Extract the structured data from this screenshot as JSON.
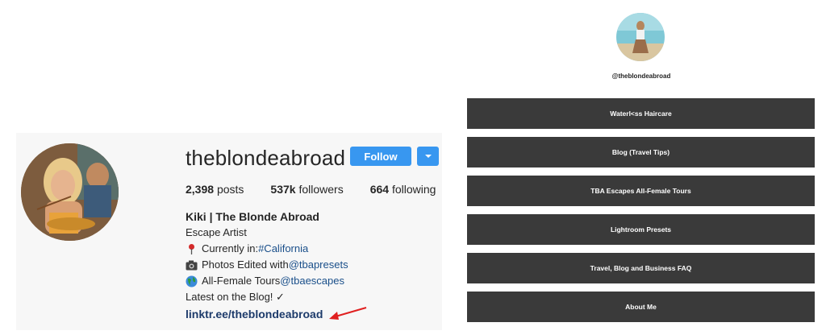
{
  "instagram": {
    "username": "theblondeabroad",
    "follow_label": "Follow",
    "stats": {
      "posts_count": "2,398",
      "posts_label": "posts",
      "followers_count": "537k",
      "followers_label": "followers",
      "following_count": "664",
      "following_label": "following"
    },
    "bio": {
      "name": "Kiki | The Blonde Abroad",
      "tagline": "Escape Artist",
      "location_prefix": "Currently in: ",
      "location_tag": "#California",
      "photos_prefix": "Photos Edited with ",
      "photos_handle": "@tbapresets",
      "tours_prefix": "All-Female Tours ",
      "tours_handle": "@tbaescapes",
      "latest": "Latest on the Blog! ✓",
      "link": "linktr.ee/theblondeabroad"
    },
    "icons": {
      "verified": "verified-badge-icon",
      "dropdown": "chevron-down-icon",
      "pin": "round-pushpin-icon",
      "camera": "camera-icon",
      "globe": "globe-icon",
      "arrow": "red-arrow-annotation"
    },
    "colors": {
      "follow_blue": "#3897f0",
      "link_blue": "#1a4f8a",
      "arrow_red": "#e02020"
    }
  },
  "linktree": {
    "handle": "@theblondeabroad",
    "buttons": [
      "Waterl<ss Haircare",
      "Blog (Travel Tips)",
      "TBA Escapes All-Female Tours",
      "Lightroom Presets",
      "Travel, Blog and Business FAQ",
      "About Me"
    ],
    "colors": {
      "button_bg": "#3a3a3a",
      "button_text": "#ffffff"
    }
  }
}
